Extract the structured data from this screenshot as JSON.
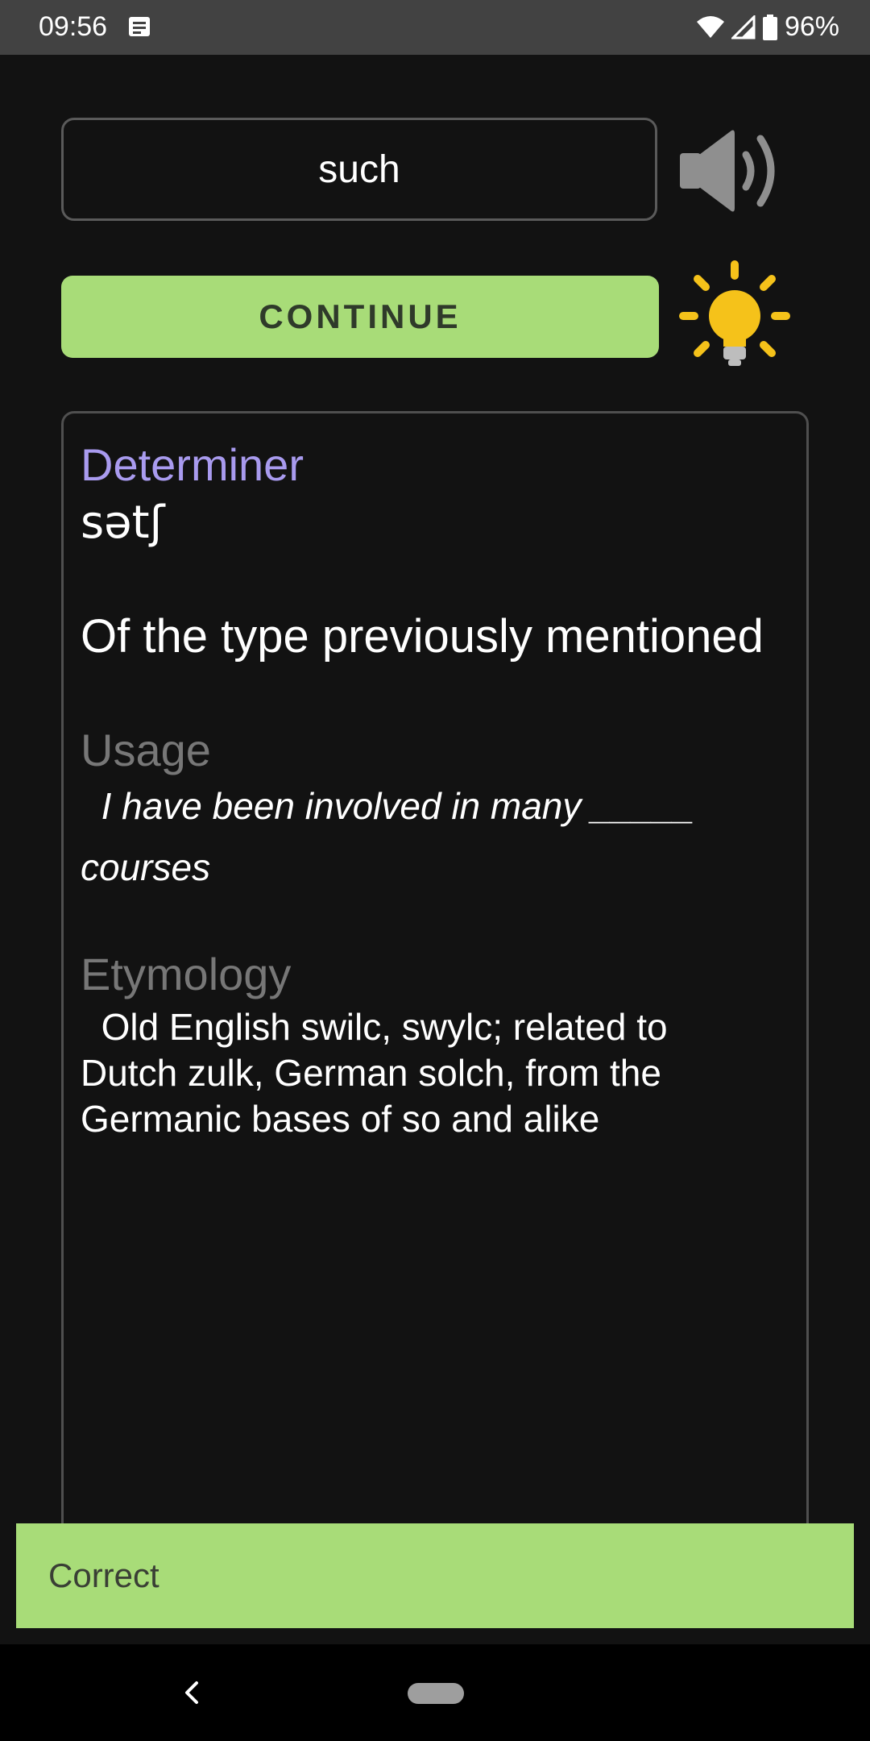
{
  "status_bar": {
    "time": "09:56",
    "battery": "96%",
    "icons": [
      "notification-icon",
      "wifi-icon",
      "signal-icon",
      "battery-icon"
    ]
  },
  "quiz": {
    "answer": "such",
    "continue_label": "CONTINUE",
    "icons": [
      "speaker-icon",
      "lightbulb-icon"
    ]
  },
  "card": {
    "part_of_speech": "Determiner",
    "phonetic": "sətʃ",
    "definition": "Of the type previously mentioned",
    "usage_heading": "Usage",
    "usage_text": "  I have been involved in many _____ courses",
    "etymology_heading": "Etymology",
    "etymology_text": "  Old English swilc, swylc; related to Dutch zulk, German solch, from the Germanic bases of so and alike"
  },
  "feedback": {
    "label": "Correct"
  },
  "colors": {
    "background": "#121212",
    "accent_green": "#a8dc78",
    "pos_purple": "#a99bef",
    "heading_gray": "#777777",
    "bulb_yellow": "#f5c21a"
  }
}
